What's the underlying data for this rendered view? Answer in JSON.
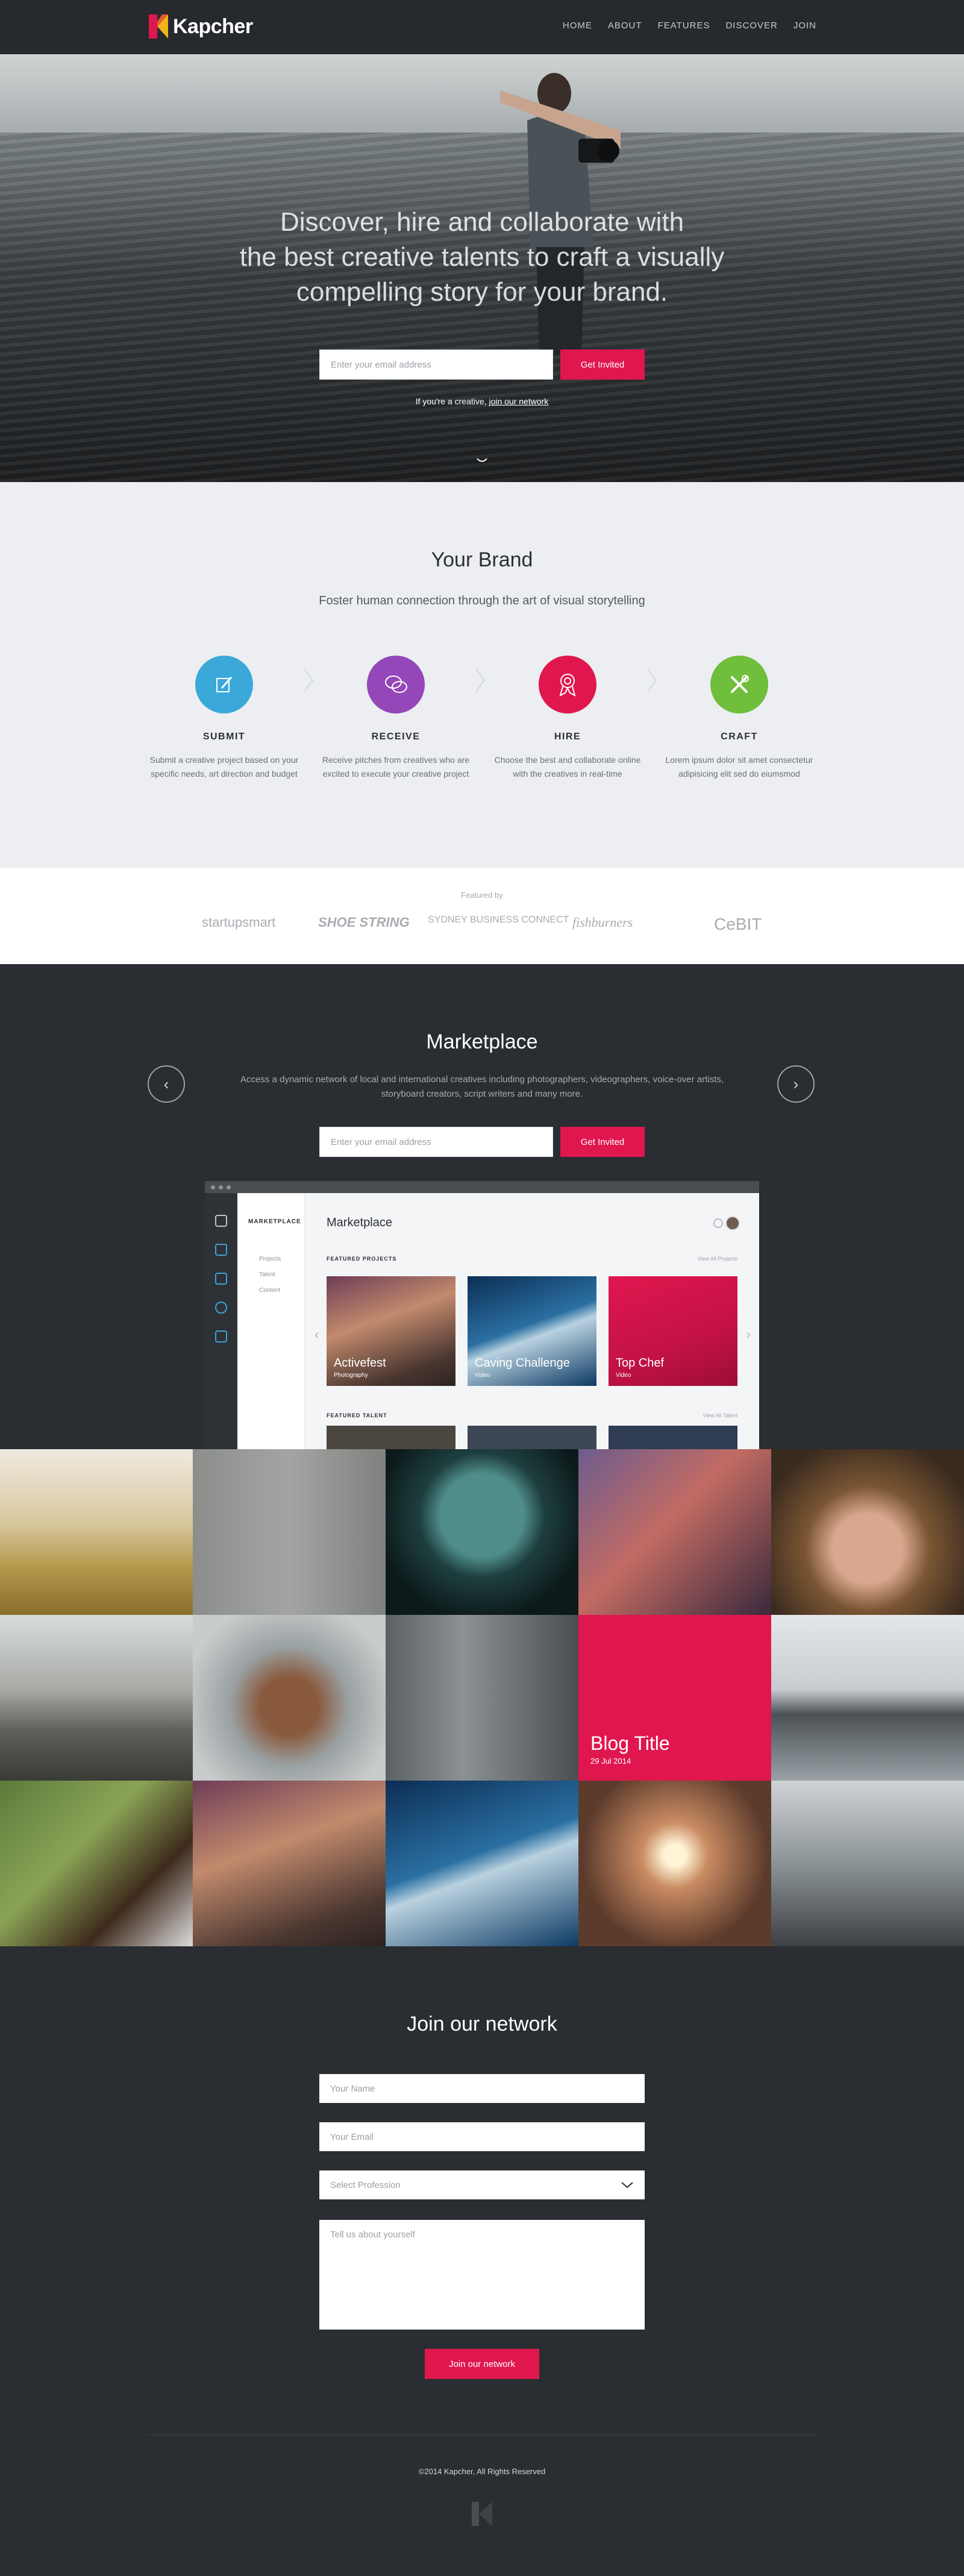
{
  "nav": {
    "brand": "Kapcher",
    "items": [
      "HOME",
      "ABOUT",
      "FEATURES",
      "DISCOVER",
      "JOIN"
    ]
  },
  "hero": {
    "headline_lines": [
      "Discover, hire and collaborate with",
      "the best creative talents to craft a visually",
      "compelling story for your brand."
    ],
    "email_placeholder": "Enter your email address",
    "cta": "Get Invited",
    "note_prefix": "If you're a creative,",
    "note_link": "join our network"
  },
  "brand": {
    "title": "Your Brand",
    "subtitle": "Foster human connection through the art of visual storytelling",
    "steps": [
      {
        "title": "SUBMIT",
        "text": "Submit a creative project based on your specific needs, art direction and budget",
        "color": "#3aa9da",
        "icon": "pencil-icon"
      },
      {
        "title": "RECEIVE",
        "text": "Receive pitches from creatives who are excited to execute your creative project",
        "color": "#9447b8",
        "icon": "chat-bubbles-icon"
      },
      {
        "title": "HIRE",
        "text": "Choose the best and collaborate online with the creatives in real-time",
        "color": "#e0174f",
        "icon": "award-icon"
      },
      {
        "title": "CRAFT",
        "text": "Lorem ipsum dolor sit amet consectetur adipisicing elit sed do eiumsmod",
        "color": "#6fbe3c",
        "icon": "tools-icon"
      }
    ]
  },
  "featured": {
    "label": "Featured by",
    "partners": [
      "startupsmart",
      "SHOE STRING",
      "SYDNEY BUSINESS CONNECT",
      "fishburners",
      "CeBIT"
    ]
  },
  "marketplace": {
    "title": "Marketplace",
    "description": "Access a dynamic network of local and international creatives including photographers, videographers, voice-over artists, storyboard creators, script writers and many more.",
    "email_placeholder": "Enter your email address",
    "cta": "Get Invited",
    "app": {
      "menu_header": "MARKETPLACE",
      "menu_items": [
        "Projects",
        "Talent",
        "Content"
      ],
      "title": "Marketplace",
      "featured_projects": "FEATURED PROJECTS",
      "view_all_projects": "View All Projects",
      "featured_talent": "FEATURED TALENT",
      "view_all_talent": "View All Talent",
      "cards": [
        {
          "title": "Activefest",
          "tag": "Photography"
        },
        {
          "title": "Caving Challenge",
          "tag": "Video"
        },
        {
          "title": "Top Chef",
          "tag": "Video"
        }
      ]
    }
  },
  "blog": {
    "title": "Blog Title",
    "date": "29 Jul 2014"
  },
  "join": {
    "title": "Join our network",
    "name_placeholder": "Your Name",
    "email_placeholder": "Your Email",
    "profession_placeholder": "Select Profession",
    "about_placeholder": "Tell us about yourself",
    "submit": "Join our network"
  },
  "footer": {
    "copyright": "©2014 Kapcher, All Rights Reserved"
  }
}
